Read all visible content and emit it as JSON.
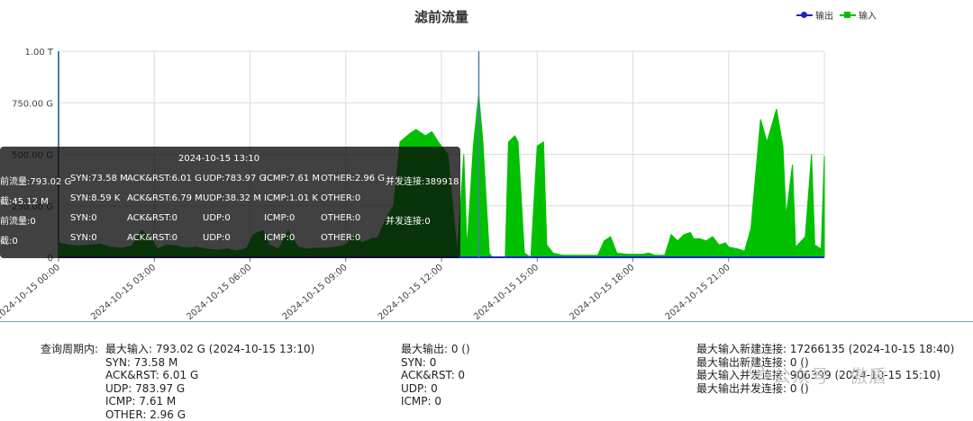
{
  "chart_data": {
    "type": "area",
    "title": "滤前流量",
    "xlabel": "",
    "ylabel": "",
    "ylim": [
      0,
      1000
    ],
    "y_unit": "G",
    "y_ticks": [
      {
        "value": 0,
        "label": "0"
      },
      {
        "value": 250,
        "label": "250.00 G"
      },
      {
        "value": 500,
        "label": "500.00 G"
      },
      {
        "value": 750,
        "label": "750.00 G"
      },
      {
        "value": 1000,
        "label": "1.00 T"
      }
    ],
    "x_range_hours": [
      0,
      24
    ],
    "x_ticks": [
      {
        "hour": 0,
        "label": "2024-10-15 00:00"
      },
      {
        "hour": 3,
        "label": "2024-10-15 03:00"
      },
      {
        "hour": 6,
        "label": "2024-10-15 06:00"
      },
      {
        "hour": 9,
        "label": "2024-10-15 09:00"
      },
      {
        "hour": 12,
        "label": "2024-10-15 12:00"
      },
      {
        "hour": 15,
        "label": "2024-10-15 15:00"
      },
      {
        "hour": 18,
        "label": "2024-10-15 18:00"
      },
      {
        "hour": 21,
        "label": "2024-10-15 21:00"
      }
    ],
    "grid": true,
    "legend_position": "top-right",
    "crosshair_hour": 13.17,
    "series": [
      {
        "name": "输出",
        "color": "#2222cc",
        "values": [
          [
            0,
            0
          ],
          [
            24,
            0
          ]
        ]
      },
      {
        "name": "输入",
        "color": "#00c000",
        "values": [
          [
            0,
            70
          ],
          [
            0.3,
            60
          ],
          [
            0.6,
            55
          ],
          [
            1,
            60
          ],
          [
            1.3,
            65
          ],
          [
            1.6,
            50
          ],
          [
            2,
            45
          ],
          [
            2.3,
            55
          ],
          [
            2.6,
            130
          ],
          [
            2.9,
            90
          ],
          [
            3.1,
            40
          ],
          [
            3.4,
            60
          ],
          [
            3.7,
            55
          ],
          [
            4,
            45
          ],
          [
            4.3,
            50
          ],
          [
            4.6,
            40
          ],
          [
            5,
            35
          ],
          [
            5.3,
            40
          ],
          [
            5.6,
            30
          ],
          [
            5.9,
            45
          ],
          [
            6.1,
            110
          ],
          [
            6.4,
            130
          ],
          [
            6.6,
            60
          ],
          [
            6.9,
            40
          ],
          [
            7.2,
            130
          ],
          [
            7.5,
            50
          ],
          [
            7.8,
            40
          ],
          [
            8.1,
            45
          ],
          [
            8.4,
            45
          ],
          [
            8.7,
            50
          ],
          [
            9,
            60
          ],
          [
            9.3,
            110
          ],
          [
            9.5,
            70
          ],
          [
            9.8,
            90
          ],
          [
            10,
            95
          ],
          [
            10.3,
            200
          ],
          [
            10.5,
            250
          ],
          [
            10.7,
            560
          ],
          [
            11,
            600
          ],
          [
            11.2,
            620
          ],
          [
            11.5,
            590
          ],
          [
            11.7,
            610
          ],
          [
            11.9,
            560
          ],
          [
            12.1,
            520
          ],
          [
            12.2,
            500
          ],
          [
            12.4,
            170
          ],
          [
            12.5,
            20
          ],
          [
            12.7,
            500
          ],
          [
            12.8,
            40
          ],
          [
            13.0,
            540
          ],
          [
            13.17,
            793
          ],
          [
            13.3,
            560
          ],
          [
            13.5,
            20
          ],
          [
            13.6,
            0
          ],
          [
            14.0,
            0
          ],
          [
            14.1,
            560
          ],
          [
            14.3,
            590
          ],
          [
            14.4,
            560
          ],
          [
            14.6,
            20
          ],
          [
            14.8,
            0
          ],
          [
            15.0,
            540
          ],
          [
            15.2,
            560
          ],
          [
            15.3,
            60
          ],
          [
            15.5,
            20
          ],
          [
            15.8,
            10
          ],
          [
            16,
            10
          ],
          [
            16.3,
            10
          ],
          [
            16.6,
            10
          ],
          [
            16.9,
            10
          ],
          [
            17.1,
            80
          ],
          [
            17.3,
            100
          ],
          [
            17.5,
            20
          ],
          [
            17.8,
            15
          ],
          [
            18,
            15
          ],
          [
            18.3,
            15
          ],
          [
            18.5,
            20
          ],
          [
            18.7,
            10
          ],
          [
            19,
            10
          ],
          [
            19.2,
            110
          ],
          [
            19.4,
            80
          ],
          [
            19.6,
            110
          ],
          [
            19.8,
            120
          ],
          [
            19.9,
            90
          ],
          [
            20.1,
            90
          ],
          [
            20.3,
            80
          ],
          [
            20.5,
            100
          ],
          [
            20.7,
            60
          ],
          [
            20.9,
            70
          ],
          [
            21.0,
            50
          ],
          [
            21.3,
            40
          ],
          [
            21.5,
            30
          ],
          [
            21.7,
            140
          ],
          [
            22.0,
            670
          ],
          [
            22.2,
            560
          ],
          [
            22.5,
            720
          ],
          [
            22.7,
            540
          ],
          [
            22.8,
            200
          ],
          [
            23.0,
            450
          ],
          [
            23.1,
            50
          ],
          [
            23.4,
            100
          ],
          [
            23.6,
            500
          ],
          [
            23.7,
            60
          ],
          [
            23.9,
            40
          ],
          [
            24,
            490
          ]
        ]
      }
    ]
  },
  "tooltip": {
    "title": "2024-10-15 13:10",
    "rows": [
      [
        "前流量:793.02 G",
        "SYN:73.58 M",
        "ACK&RST:6.01 G",
        "UDP:783.97 G",
        "ICMP:7.61 M",
        "OTHER:2.96 G",
        "并发连接:389918"
      ],
      [
        "截:45.12 M",
        "SYN:8.59 K",
        "ACK&RST:6.79 M",
        "UDP:38.32 M",
        "ICMP:1.01 K",
        "OTHER:0",
        ""
      ],
      [
        "前流量:0",
        "SYN:0",
        "ACK&RST:0",
        "UDP:0",
        "ICMP:0",
        "OTHER:0",
        "并发连接:0"
      ],
      [
        "截:0",
        "SYN:0",
        "ACK&RST:0",
        "UDP:0",
        "ICMP:0",
        "OTHER:0",
        ""
      ]
    ]
  },
  "legend": {
    "output_label": "输出",
    "input_label": "输入"
  },
  "summary": {
    "period_label": "查询周期内:",
    "input_lines": [
      "最大输入: 793.02 G (2024-10-15 13:10)",
      "SYN: 73.58 M",
      "ACK&RST: 6.01 G",
      "UDP: 783.97 G",
      "ICMP: 7.61 M",
      "OTHER: 2.96 G"
    ],
    "output_lines": [
      "最大输出: 0 ()",
      "SYN: 0",
      "ACK&RST: 0",
      "UDP: 0",
      "ICMP: 0"
    ],
    "conn_lines": [
      "最大输入新建连接: 17266135 (2024-10-15 18:40)",
      "最大输出新建连接: 0 ()",
      "最大输入并发连接: 906399 (2024-10-15 15:10)",
      "最大输出并发连接: 0 ()"
    ]
  },
  "watermark": "公众号 · 傲盾"
}
